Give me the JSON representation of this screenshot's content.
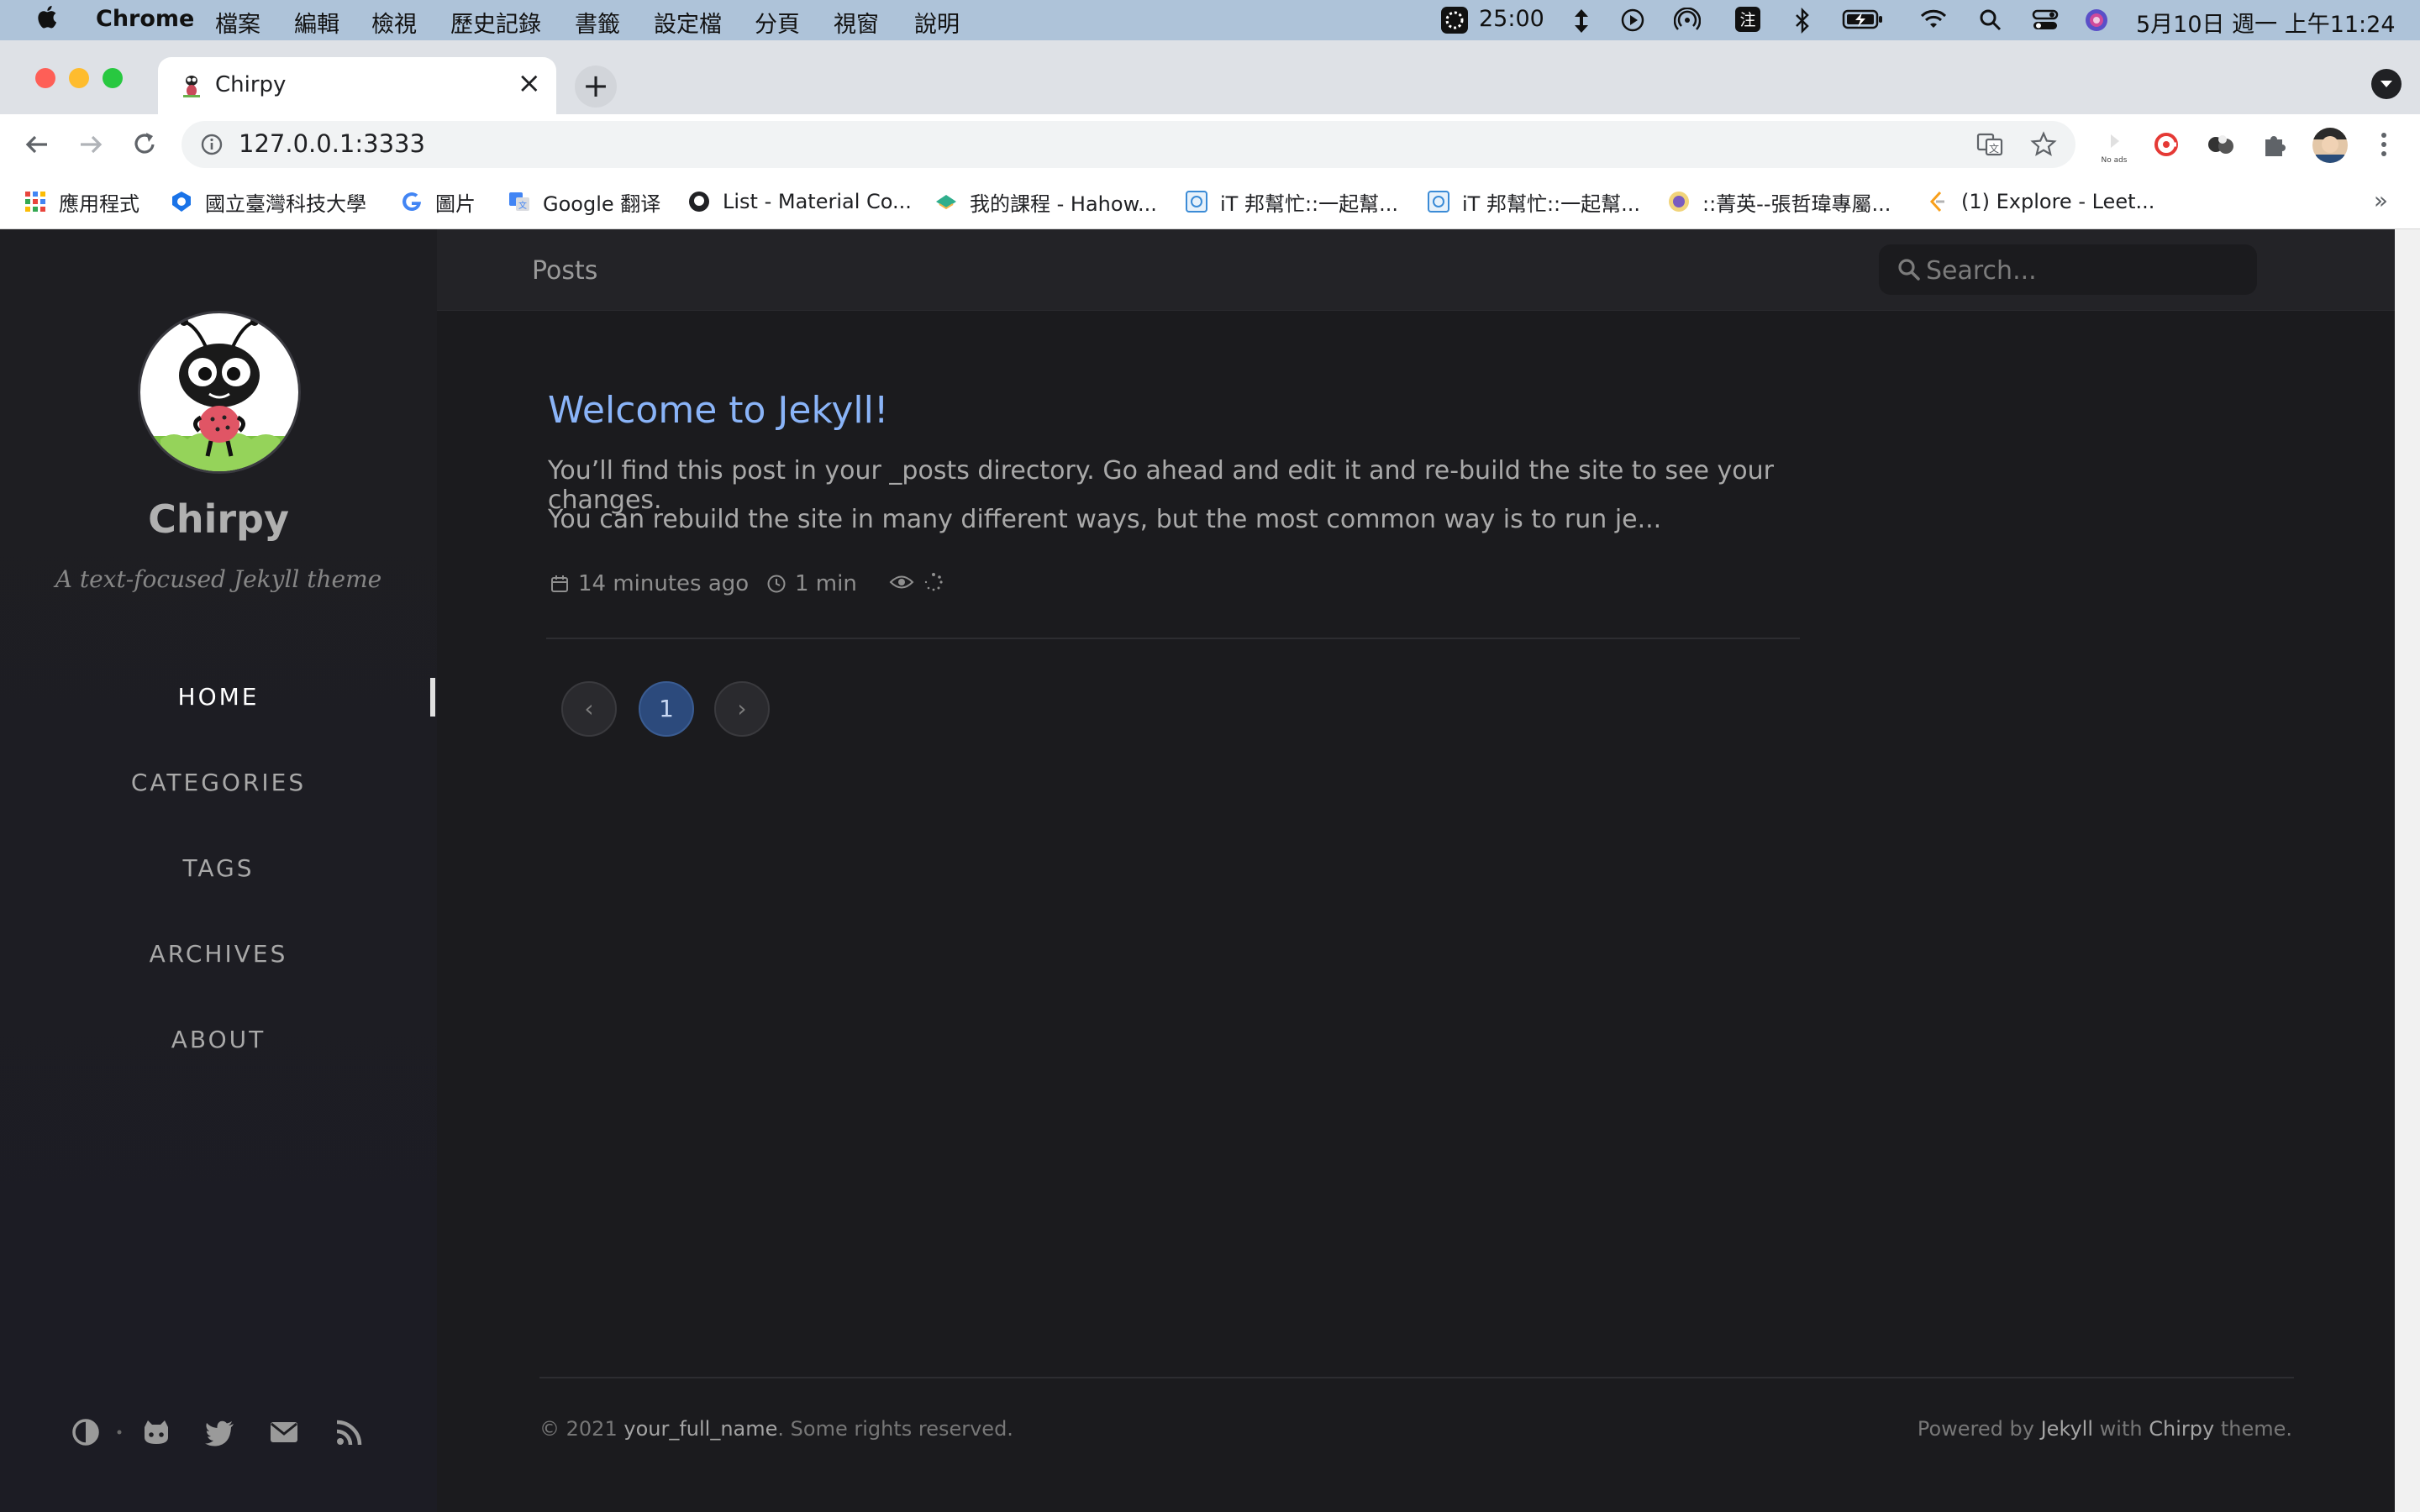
{
  "menubar": {
    "app": "Chrome",
    "items": [
      "檔案",
      "編輯",
      "檢視",
      "歷史記錄",
      "書籤",
      "設定檔",
      "分頁",
      "視窗",
      "說明"
    ],
    "timer": "25:00",
    "clock": "5月10日 週一 上午11:24"
  },
  "browser": {
    "tab_title": "Chirpy",
    "new_tab_label": "+",
    "url": "127.0.0.1:3333",
    "bookmarks": [
      {
        "label": "應用程式",
        "icon": "apps-grid-icon",
        "color": "#e8453c"
      },
      {
        "label": "國立臺灣科技大學",
        "icon": "ntust-icon",
        "color": "#1a73e8"
      },
      {
        "label": "圖片",
        "icon": "google-g-icon",
        "color": "#4285f4"
      },
      {
        "label": "Google 翻译",
        "icon": "google-translate-icon",
        "color": "#4285f4"
      },
      {
        "label": "List - Material Co...",
        "icon": "github-icon",
        "color": "#202124"
      },
      {
        "label": "我的課程 - Hahow...",
        "icon": "hahow-icon",
        "color": "#2fae8c"
      },
      {
        "label": "iT 邦幫忙::一起幫...",
        "icon": "ithome-icon",
        "color": "#3b8bd6"
      },
      {
        "label": "iT 邦幫忙::一起幫...",
        "icon": "ithome-icon",
        "color": "#3b8bd6"
      },
      {
        "label": "::菁英--張哲瑋專屬...",
        "icon": "elite-icon",
        "color": "#7a5cc0"
      },
      {
        "label": "(1) Explore - Leet...",
        "icon": "leetcode-icon",
        "color": "#f89f1b"
      }
    ],
    "more_bookmarks": "»",
    "extension_label": "No ads"
  },
  "sidebar": {
    "title": "Chirpy",
    "subtitle": "A text-focused Jekyll theme",
    "nav": [
      {
        "label": "HOME",
        "active": true
      },
      {
        "label": "CATEGORIES",
        "active": false
      },
      {
        "label": "TAGS",
        "active": false
      },
      {
        "label": "ARCHIVES",
        "active": false
      },
      {
        "label": "ABOUT",
        "active": false
      }
    ]
  },
  "topbar": {
    "breadcrumb": "Posts",
    "search_placeholder": "Search..."
  },
  "post": {
    "title": "Welcome to Jekyll!",
    "excerpt_line1": "You’ll find this post in your _posts directory. Go ahead and edit it and re-build the site to see your changes.",
    "excerpt_line2": "You can rebuild the site in many different ways, but the most common way is to run je...",
    "date": "14 minutes ago",
    "read_time": "1 min"
  },
  "pagination": {
    "prev": "‹",
    "current": "1",
    "next": "›"
  },
  "footer": {
    "copyright_prefix": "© 2021",
    "author": "your_full_name",
    "rights": ". Some rights reserved.",
    "powered_by": "Powered by",
    "jekyll": "Jekyll",
    "with": "with",
    "chirpy": "Chirpy",
    "theme_suffix": "theme."
  },
  "colors": {
    "accent_link": "#8ab4f8",
    "page_bg": "#1b1b1e",
    "sidebar_bg": "#1e1e22",
    "menubar_bg": "#aec3d9"
  }
}
